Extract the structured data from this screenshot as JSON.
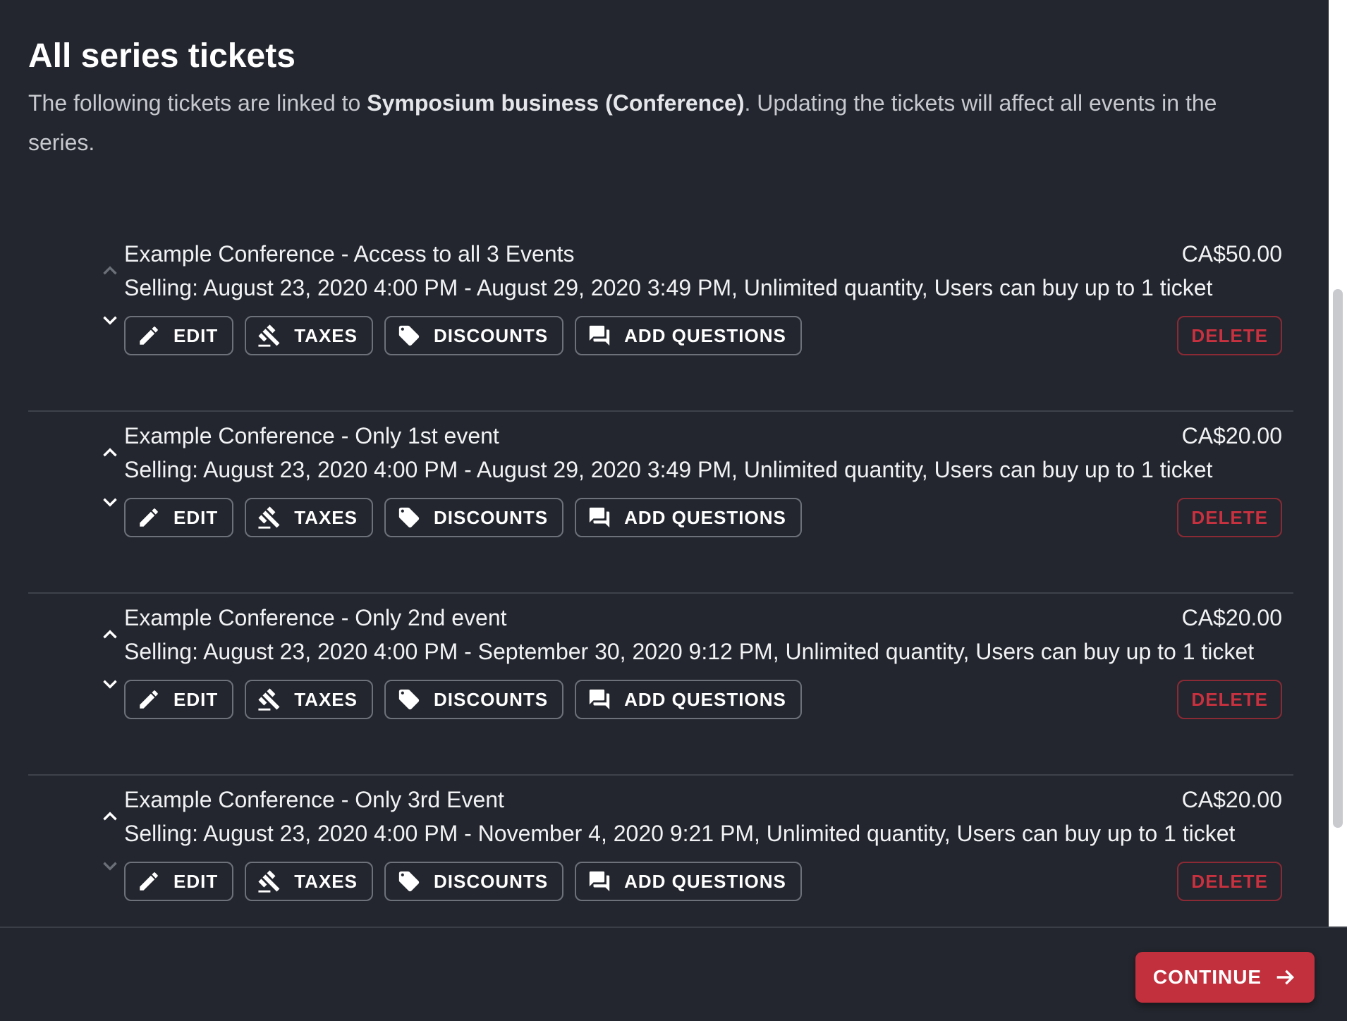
{
  "header": {
    "title": "All series tickets",
    "intro_before": "The following tickets are linked to ",
    "intro_bold": "Symposium business (Conference)",
    "intro_after": ". Updating the tickets will affect all events in the series."
  },
  "buttons": {
    "edit": "EDIT",
    "taxes": "TAXES",
    "discounts": "DISCOUNTS",
    "add_questions": "ADD QUESTIONS",
    "delete": "DELETE"
  },
  "tickets": [
    {
      "name": "Example Conference - Access to all 3 Events",
      "price": "CA$50.00",
      "selling": "Selling: August 23, 2020 4:00 PM - August 29, 2020 3:49 PM, Unlimited quantity, Users can buy up to 1 ticket"
    },
    {
      "name": "Example Conference - Only 1st event",
      "price": "CA$20.00",
      "selling": "Selling: August 23, 2020 4:00 PM - August 29, 2020 3:49 PM, Unlimited quantity, Users can buy up to 1 ticket"
    },
    {
      "name": "Example Conference - Only 2nd event",
      "price": "CA$20.00",
      "selling": "Selling: August 23, 2020 4:00 PM - September 30, 2020 9:12 PM, Unlimited quantity, Users can buy up to 1 ticket"
    },
    {
      "name": "Example Conference - Only 3rd Event",
      "price": "CA$20.00",
      "selling": "Selling: August 23, 2020 4:00 PM - November 4, 2020 9:21 PM, Unlimited quantity, Users can buy up to 1 ticket"
    }
  ],
  "footer": {
    "continue_label": "CONTINUE"
  },
  "colors": {
    "background": "#23262e",
    "accent": "#c2303d",
    "danger": "#c8313f"
  }
}
